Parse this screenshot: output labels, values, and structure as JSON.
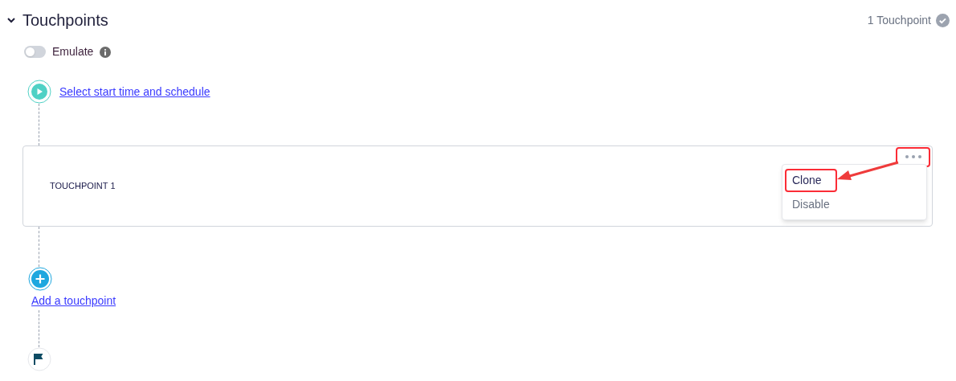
{
  "section": {
    "title": "Touchpoints",
    "expanded": true,
    "count": "1 Touchpoint"
  },
  "emulate": {
    "label": "Emulate",
    "on": false
  },
  "start_link": "Select start time and schedule",
  "touchpoints": [
    {
      "label": "TOUCHPOINT 1",
      "menu_open": true,
      "more_highlighted": true,
      "menu": [
        {
          "label": "Clone",
          "disabled": false,
          "highlighted": true
        },
        {
          "label": "Disable",
          "disabled": true,
          "highlighted": false
        }
      ]
    }
  ],
  "add_link": "Add a touchpoint"
}
